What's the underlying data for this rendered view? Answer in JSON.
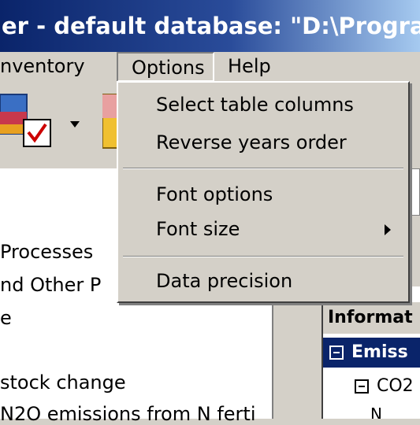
{
  "window": {
    "title": "er - default database: \"D:\\Program F"
  },
  "menubar": {
    "inventory": "nventory",
    "options": "Options",
    "help": "Help"
  },
  "dropdown": {
    "items": [
      {
        "label": "Select table columns"
      },
      {
        "label": "Reverse years order"
      },
      {
        "label": "Font options"
      },
      {
        "label": "Font size"
      },
      {
        "label": "Data precision"
      }
    ]
  },
  "tree": {
    "rows": [
      "Processes",
      "nd Other P",
      "e",
      "stock change",
      "N2O emissions from N ferti"
    ]
  },
  "right_panel": {
    "header": "Informat",
    "emissions": "Emiss",
    "co2": "CO2",
    "child": "N"
  },
  "icons": [
    "database-checklist-icon",
    "dropdown-arrow-icon",
    "database-icon"
  ]
}
